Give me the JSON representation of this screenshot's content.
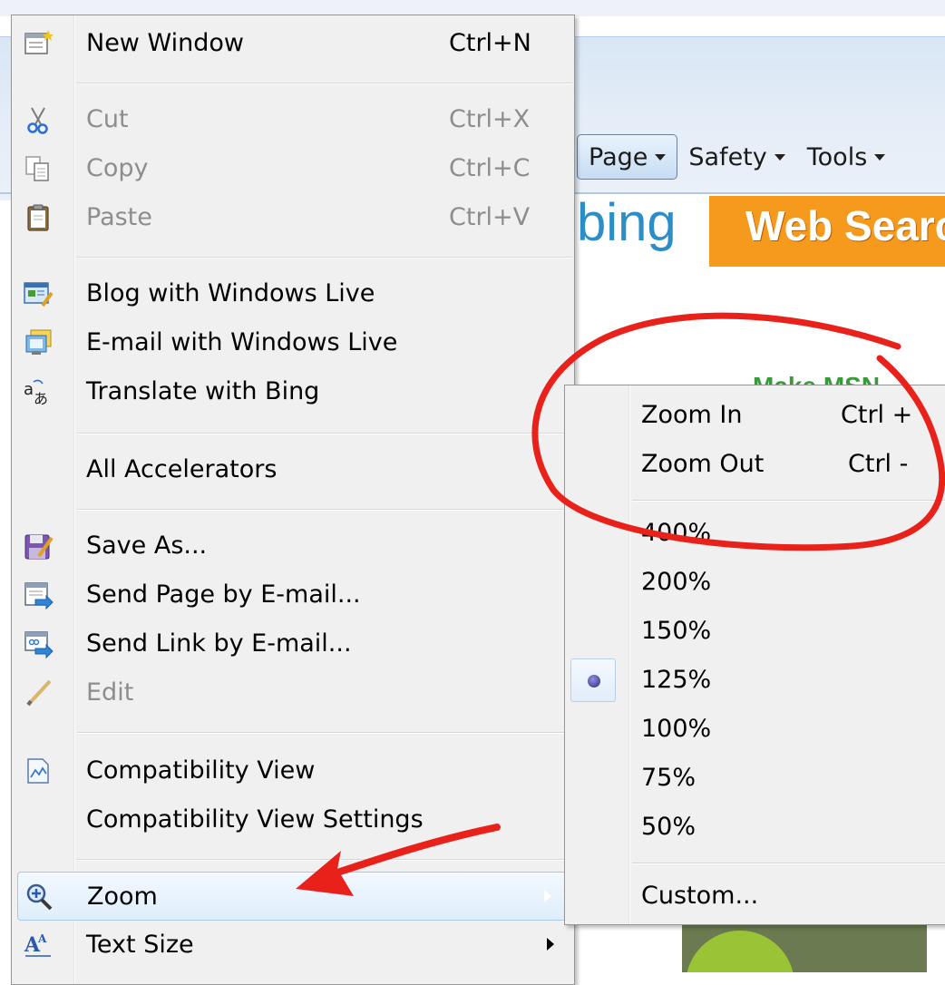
{
  "toolbar": {
    "page": "Page",
    "safety": "Safety",
    "tools": "Tools"
  },
  "page_content": {
    "bing_logo": "bing",
    "banner": "Web Search",
    "green_text": "Make MSN"
  },
  "main_menu": {
    "new_window": {
      "label": "New Window",
      "shortcut": "Ctrl+N"
    },
    "cut": {
      "label": "Cut",
      "shortcut": "Ctrl+X"
    },
    "copy": {
      "label": "Copy",
      "shortcut": "Ctrl+C"
    },
    "paste": {
      "label": "Paste",
      "shortcut": "Ctrl+V"
    },
    "blog": {
      "label": "Blog with Windows Live"
    },
    "email_live": {
      "label": "E-mail with Windows Live"
    },
    "translate": {
      "label": "Translate with Bing"
    },
    "all_accelerators": {
      "label": "All Accelerators"
    },
    "save_as": {
      "label": "Save As..."
    },
    "send_page": {
      "label": "Send Page by E-mail..."
    },
    "send_link": {
      "label": "Send Link by E-mail..."
    },
    "edit": {
      "label": "Edit"
    },
    "compat_view": {
      "label": "Compatibility View"
    },
    "compat_settings": {
      "label": "Compatibility View Settings"
    },
    "zoom": {
      "label": "Zoom"
    },
    "text_size": {
      "label": "Text Size"
    }
  },
  "zoom_menu": {
    "zoom_in": {
      "label": "Zoom In",
      "shortcut": "Ctrl +"
    },
    "zoom_out": {
      "label": "Zoom Out",
      "shortcut": "Ctrl -"
    },
    "levels": [
      "400%",
      "200%",
      "150%",
      "125%",
      "100%",
      "75%",
      "50%"
    ],
    "selected": "125%",
    "custom": "Custom..."
  },
  "colors": {
    "menu_bg": "#f0f0f0",
    "annotation_red": "#e8221b",
    "highlight": "#dfeefc",
    "banner_orange": "#f59a1d"
  }
}
